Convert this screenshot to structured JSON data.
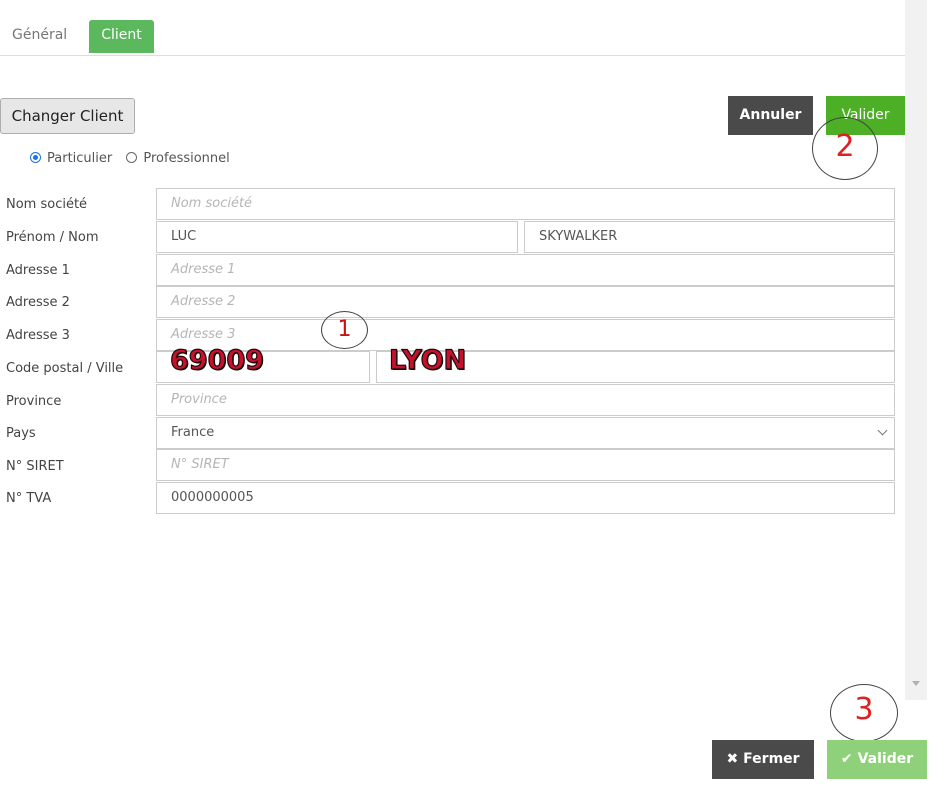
{
  "tabs": {
    "general": "Général",
    "client": "Client"
  },
  "actions": {
    "change_client": "Changer Client",
    "cancel": "Annuler",
    "validate": "Valider"
  },
  "client_type": {
    "options": [
      "Particulier",
      "Professionnel"
    ],
    "selected": "Particulier"
  },
  "form": {
    "labels": {
      "company": "Nom société",
      "name": "Prénom / Nom",
      "address1": "Adresse 1",
      "address2": "Adresse 2",
      "address3": "Adresse 3",
      "postal_city": "Code postal / Ville",
      "province": "Province",
      "country": "Pays",
      "siret": "N° SIRET",
      "vat": "N° TVA"
    },
    "placeholders": {
      "company": "Nom société",
      "address1": "Adresse 1",
      "address2": "Adresse 2",
      "address3": "Adresse 3",
      "province": "Province",
      "siret": "N° SIRET"
    },
    "values": {
      "first_name": "LUC",
      "last_name": "SKYWALKER",
      "postal_code": "69009",
      "city": "LYON",
      "country": "France",
      "vat": "0000000005"
    }
  },
  "annotations": {
    "step1": "1",
    "step2": "2",
    "step3": "3"
  },
  "footer": {
    "close": "Fermer",
    "validate": "Valider"
  },
  "icons": {
    "close": "close-icon",
    "check": "check-icon"
  },
  "colors": {
    "accent_green": "#4caf26",
    "dark_button": "#4a4a4a",
    "annotation_red": "#e02020"
  }
}
